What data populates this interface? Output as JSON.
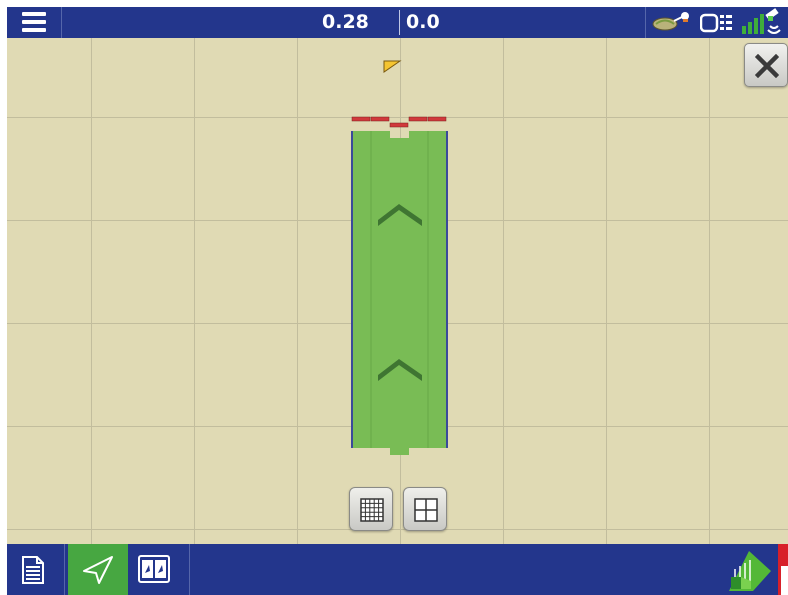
{
  "toolbar": {
    "menu_icon": "hamburger-menu-icon",
    "readout_1": "0.28",
    "readout_2": "0.0",
    "status_icons": [
      "gps-antenna-icon",
      "implement-section-icon",
      "satellite-signal-icon"
    ]
  },
  "map": {
    "background_color": "#e0dab4",
    "grid_color": "#c2bd9d",
    "coverage_color": "#79bc55",
    "section_color": "#d0393b",
    "vehicle_marker_color": "#f5c531",
    "direction_arrows": 2,
    "close_icon": "close-x-icon",
    "view_buttons": [
      "fine-grid-icon",
      "coarse-grid-icon"
    ]
  },
  "bottombar": {
    "items": [
      "document-icon",
      "navigation-arrow-icon",
      "split-view-icon"
    ],
    "active_item": "navigation-arrow-icon",
    "right_items": [
      "coverage-map-icon",
      "alert-icon"
    ],
    "active_color": "#47a741",
    "bar_color": "#23368c"
  }
}
